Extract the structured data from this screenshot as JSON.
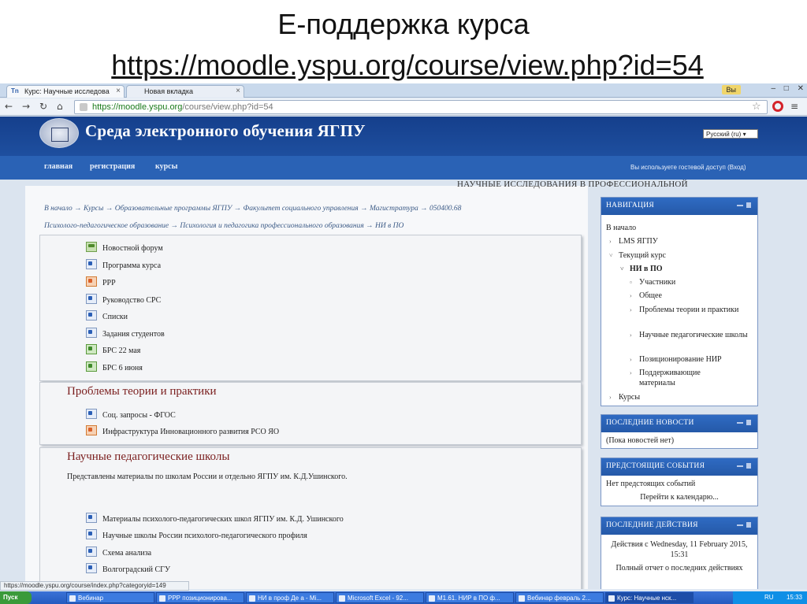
{
  "slide": {
    "title": "Е-поддержка курса",
    "link": "https://moodle.yspu.org/course/view.php?id=54"
  },
  "browser": {
    "tabs": [
      {
        "label": "Курс: Научные исследова",
        "favicon": "Tn"
      },
      {
        "label": "Новая вкладка",
        "favicon": ""
      }
    ],
    "profile_label": "Вы",
    "address_host": "https://moodle.yspu.org",
    "address_path": "/course/view.php?id=54",
    "status_url": "https://moodle.yspu.org/course/index.php?categoryid=149"
  },
  "moodle": {
    "site_title": "Среда электронного обучения ЯГПУ",
    "language": "Русский (ru)",
    "nav": [
      "главная",
      "регистрация",
      "курсы"
    ],
    "guest_text": "Вы используете гостевой доступ (Вход)",
    "course_title": "НАУЧНЫЕ ИССЛЕДОВАНИЯ В ПРОФЕССИОНАЛЬНОЙ",
    "breadcrumb_line1": "В начало → Курсы → Образовательные программы ЯГПУ → Факультет социального управления → Магистратура → 050400.68",
    "breadcrumb_line2": "Психолого-педагогическое образование → Психология и педагогика профессионального образования → НИ в ПО",
    "section0": [
      {
        "label": "Новостной форум",
        "type": "forum"
      },
      {
        "label": "Программа курса",
        "type": "doc"
      },
      {
        "label": "РРР",
        "type": "ppt"
      },
      {
        "label": "Руководство СРС",
        "type": "doc"
      },
      {
        "label": "Списки",
        "type": "doc"
      },
      {
        "label": "Задания студентов",
        "type": "doc"
      },
      {
        "label": "БРС 22 мая",
        "type": "xls"
      },
      {
        "label": "БРС 6 июня",
        "type": "xls"
      }
    ],
    "section1": {
      "title": "Проблемы теории и практики",
      "items": [
        {
          "label": "Соц. запросы - ФГОС",
          "type": "doc"
        },
        {
          "label": "Инфраструктура Инновационного развития РСО ЯО",
          "type": "ppt"
        }
      ]
    },
    "section2": {
      "title": "Научные педагогические школы",
      "summary": "Представлены материалы по школам России и отдельно ЯГПУ им. К.Д.Ушинского.",
      "items": [
        {
          "label": "Материалы психолого-педагогических школ ЯГПУ им. К.Д. Ушинского",
          "type": "doc"
        },
        {
          "label": "Научные школы России психолого-педагогического профиля",
          "type": "doc"
        },
        {
          "label": "Схема анализа",
          "type": "doc"
        },
        {
          "label": "Волгоградский СГУ",
          "type": "doc"
        }
      ]
    },
    "blocks": {
      "navigation": {
        "title": "НАВИГАЦИЯ",
        "home": "В начало",
        "lms": "LMS ЯГПУ",
        "current_course": "Текущий курс",
        "course_short": "НИ в ПО",
        "items": [
          "Участники",
          "Общее",
          "Проблемы теории и практики",
          "Научные педагогические школы",
          "Позиционирование НИР",
          "Поддерживающие материалы"
        ],
        "courses": "Курсы"
      },
      "news": {
        "title": "ПОСЛЕДНИЕ НОВОСТИ",
        "text": "(Пока новостей нет)"
      },
      "events": {
        "title": "ПРЕДСТОЯЩИЕ СОБЫТИЯ",
        "text": "Нет предстоящих событий",
        "link": "Перейти к календарю..."
      },
      "activity": {
        "title": "ПОСЛЕДНИЕ ДЕЙСТВИЯ",
        "text": "Действия с Wednesday, 11 February 2015, 15:31",
        "link": "Полный отчет о последних действиях"
      }
    }
  },
  "taskbar": {
    "start": "Пуск",
    "tasks": [
      "Вебинар",
      "РРР позиционирова...",
      "НИ в проф Де а - Mi...",
      "Microsoft Excel - 92...",
      "M1.61. НИР в ПО ф...",
      "Вебинар февраль 2...",
      "Курс: Научные нск..."
    ],
    "lang": "RU",
    "time": "15:33"
  }
}
